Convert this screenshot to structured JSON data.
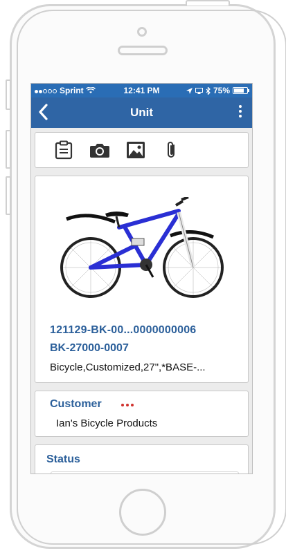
{
  "status_bar": {
    "carrier": "Sprint",
    "time": "12:41 PM",
    "battery": "75%"
  },
  "nav": {
    "title": "Unit",
    "back_icon": "chevron-left-icon",
    "menu_icon": "more-vertical-icon"
  },
  "toolbar": {
    "icons": [
      "clipboard-icon",
      "camera-icon",
      "image-icon",
      "paperclip-icon"
    ]
  },
  "product": {
    "image": "bicycle-photo",
    "serial": "121129-BK-00...0000000006",
    "part_number": "BK-27000-0007",
    "description": "Bicycle,Customized,27\",*BASE-..."
  },
  "customer": {
    "label": "Customer",
    "value": "Ian's Bicycle Products"
  },
  "status": {
    "label": "Status"
  },
  "colors": {
    "status_bar": "#2a6db5",
    "nav_bar": "#2f65a5",
    "accent_text": "#2b5f9a",
    "indicator_dots": "#d0312d"
  }
}
